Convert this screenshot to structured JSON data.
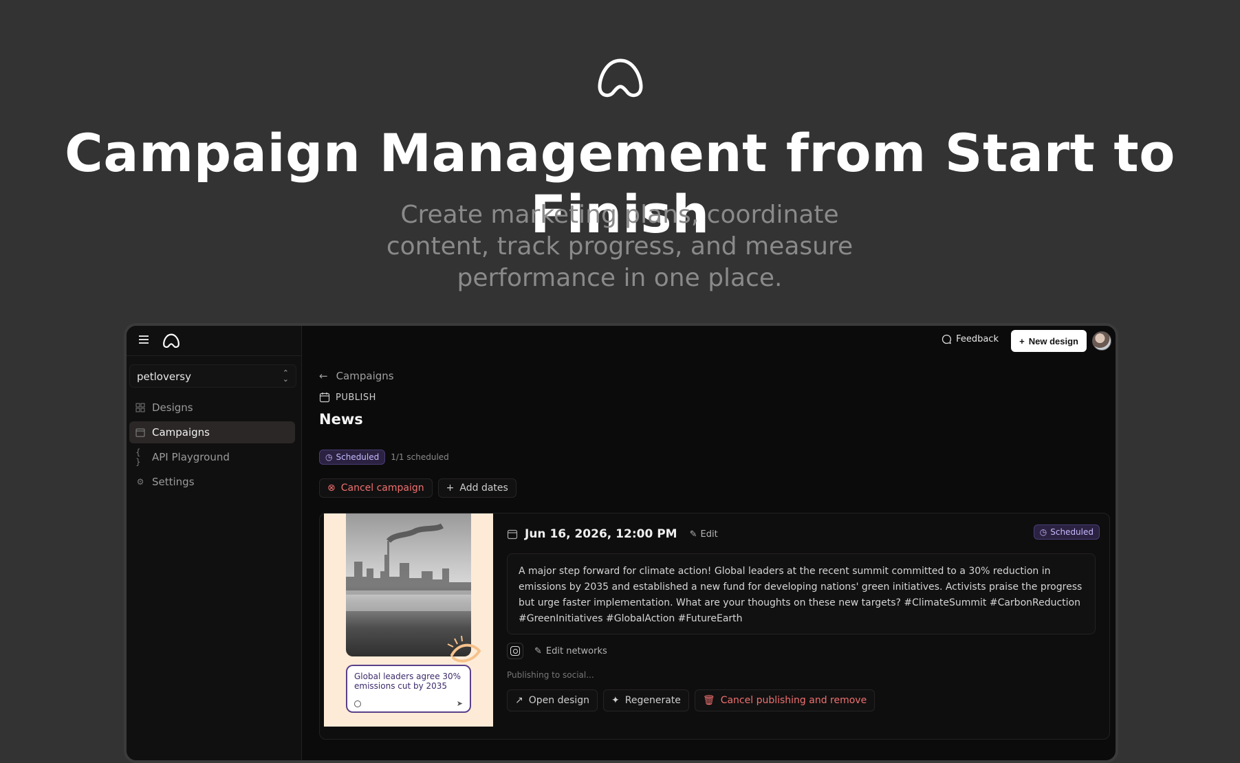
{
  "hero": {
    "title": "Campaign Management from Start to Finish",
    "subtitle": "Create marketing plans, coordinate content, track progress, and measure performance in one place."
  },
  "sidebar": {
    "org": "petloversy",
    "items": [
      {
        "label": "Designs",
        "icon": "grid-icon",
        "active": false
      },
      {
        "label": "Campaigns",
        "icon": "calendar-icon",
        "active": true
      },
      {
        "label": "API Playground",
        "icon": "braces-icon",
        "active": false
      },
      {
        "label": "Settings",
        "icon": "gear-icon",
        "active": false
      }
    ]
  },
  "topbar": {
    "feedback": "Feedback",
    "new_design": "New design"
  },
  "main": {
    "breadcrumb": "Campaigns",
    "section": "PUBLISH",
    "title": "News",
    "status": "Scheduled",
    "scheduled_count": "1/1 scheduled",
    "cancel_campaign": "Cancel campaign",
    "add_dates": "Add dates"
  },
  "post": {
    "date": "Jun 16, 2026, 12:00 PM",
    "edit": "Edit",
    "status": "Scheduled",
    "text": "A major step forward for climate action! Global leaders at the recent summit committed to a 30% reduction in emissions by 2035 and established a new fund for developing nations' green initiatives. Activists praise the progress but urge faster implementation. What are your thoughts on these new targets? #ClimateSummit #CarbonReduction #GreenInitiatives #GlobalAction #FutureEarth",
    "preview_caption": "Global leaders agree 30% emissions cut by 2035",
    "edit_networks": "Edit networks",
    "publishing_status": "Publishing to social...",
    "open_design": "Open design",
    "regenerate": "Regenerate",
    "cancel_publishing": "Cancel publishing and remove"
  },
  "colors": {
    "background": "#333333",
    "app_bg": "#0c0b0b",
    "accent_purple": "#c8b9ff",
    "danger": "#f07070"
  }
}
